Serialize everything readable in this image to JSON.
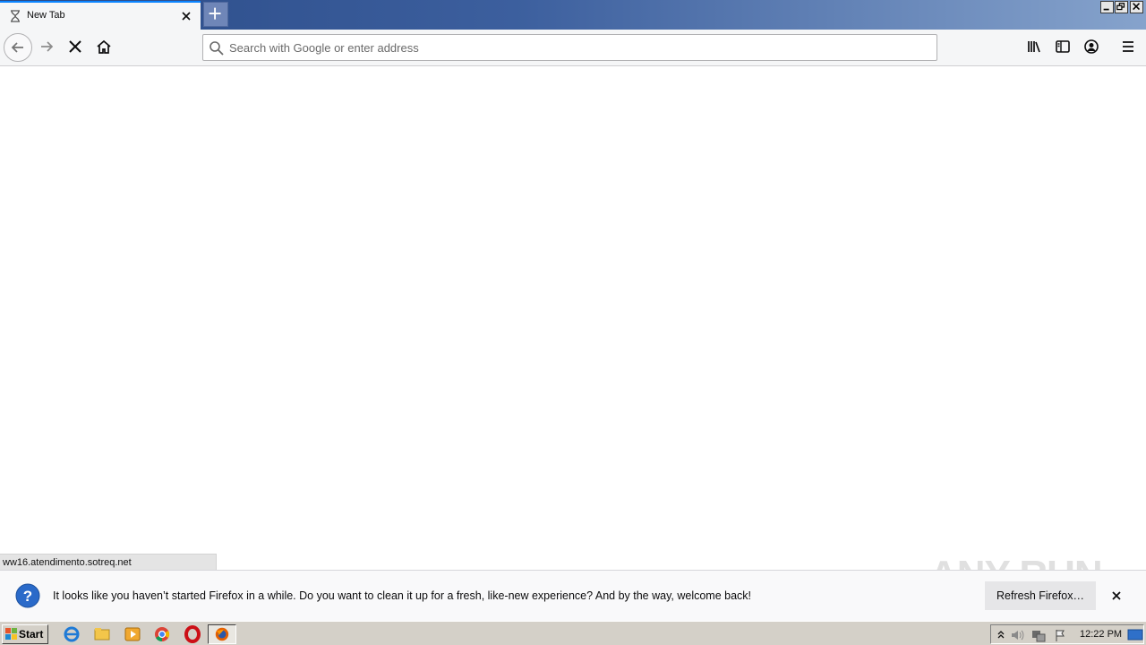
{
  "tab": {
    "title": "New Tab"
  },
  "urlbar": {
    "placeholder": "Search with Google or enter address",
    "value": ""
  },
  "status": {
    "text": "ww16.atendimento.sotreq.net"
  },
  "notification": {
    "message": "It looks like you haven’t started Firefox in a while. Do you want to clean it up for a fresh, like-new experience? And by the way, welcome back!",
    "button_label": "Refresh Firefox…"
  },
  "watermark": {
    "text": "ANY RUN"
  },
  "taskbar": {
    "start_label": "Start",
    "clock": "12:22 PM",
    "apps": [
      "internet-explorer-icon",
      "file-explorer-icon",
      "media-player-icon",
      "chrome-icon",
      "opera-icon",
      "firefox-icon"
    ]
  },
  "colors": {
    "accent": "#0a84ff",
    "titlebar": "#2a4a86",
    "toolbar": "#f5f6f7",
    "taskbar": "#d4d0c8"
  }
}
